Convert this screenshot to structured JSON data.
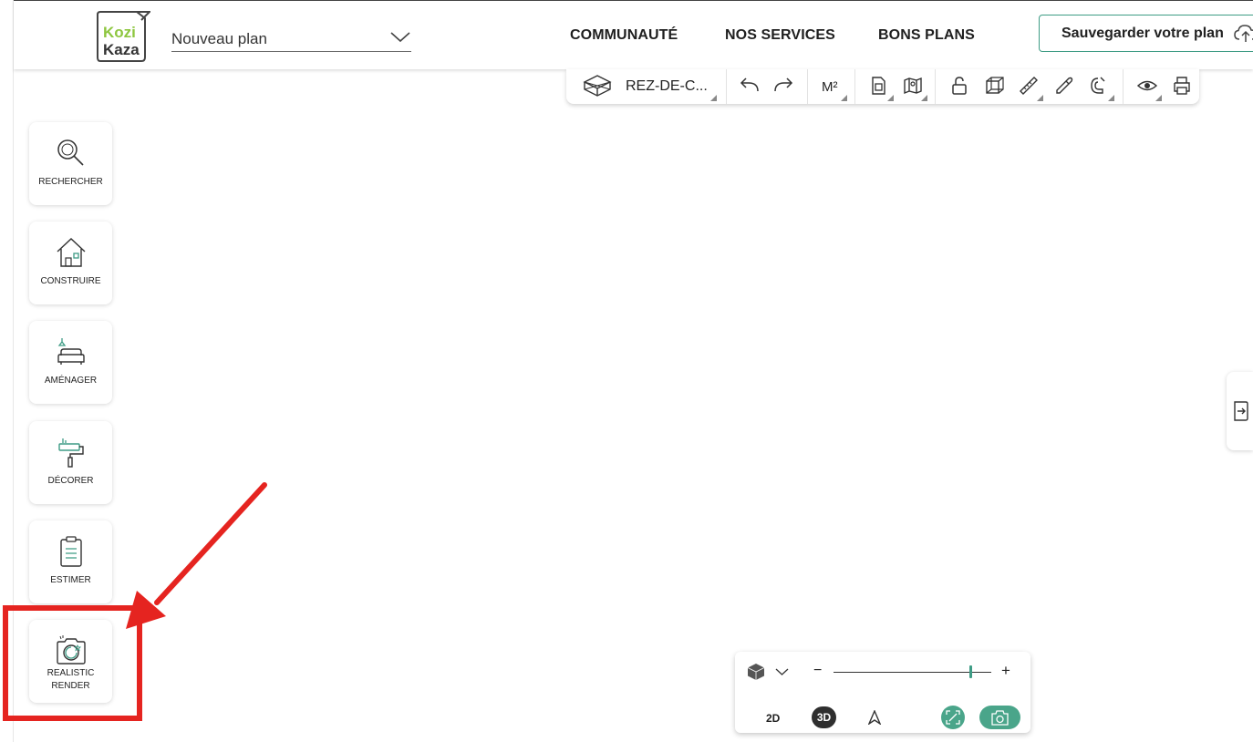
{
  "header": {
    "logo": {
      "top": "Kozi",
      "bottom": "Kaza"
    },
    "plan_name": "Nouveau plan",
    "nav": [
      "COMMUNAUTÉ",
      "NOS SERVICES",
      "BONS PLANS"
    ],
    "save_label": "Sauvegarder votre plan"
  },
  "toolbar": {
    "floor_label": "REZ-DE-C...",
    "units_label": "M²",
    "icons": [
      "3d-box-icon",
      "undo-icon",
      "redo-icon",
      "units-icon",
      "document-icon",
      "map-icon",
      "lock-icon",
      "wireframe-cube-icon",
      "ruler-icon",
      "eyedropper-icon",
      "magnet-icon",
      "eye-icon",
      "print-icon"
    ]
  },
  "sidebar": {
    "items": [
      {
        "label": "RECHERCHER",
        "icon": "search-icon"
      },
      {
        "label": "CONSTRUIRE",
        "icon": "house-icon"
      },
      {
        "label": "AMÉNAGER",
        "icon": "sofa-lamp-icon"
      },
      {
        "label": "DÉCORER",
        "icon": "paint-roller-icon"
      },
      {
        "label": "ESTIMER",
        "icon": "clipboard-icon"
      },
      {
        "label_line1": "REALISTIC",
        "label_line2": "RENDER",
        "icon": "camera-icon"
      }
    ]
  },
  "view_control": {
    "minus": "−",
    "plus": "+",
    "zoom_fraction": 0.87,
    "mode_2d": "2D",
    "mode_3d": "3D",
    "active_mode": "3D"
  },
  "colors": {
    "accent": "#3e9c85",
    "annotation_red": "#e52420",
    "logo_green": "#8dc63f"
  }
}
